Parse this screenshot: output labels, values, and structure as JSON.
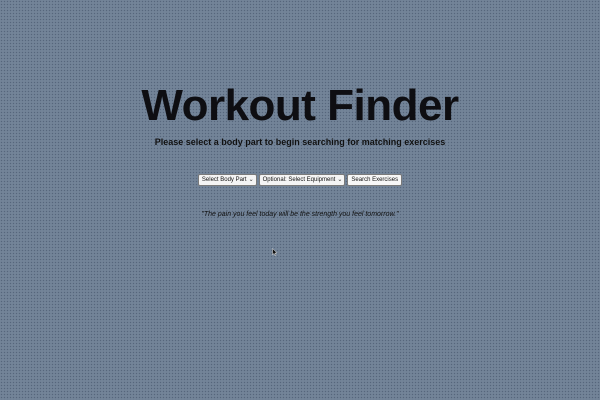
{
  "header": {
    "title": "Workout Finder",
    "subtitle": "Please select a body part to begin searching for matching exercises"
  },
  "controls": {
    "body_part_select": {
      "selected": "Select Body Part"
    },
    "equipment_select": {
      "selected": "Optional: Select Equipment"
    },
    "search_button_label": "Search Exercises"
  },
  "quote": {
    "text": "\"The pain you feel today will be the strength you feel tomorrow.\""
  },
  "icons": {
    "dropdown": "chevron-down-icon",
    "pointer": "mouse-pointer-icon"
  },
  "colors": {
    "background": "#6f8095",
    "text": "#0e0e12"
  }
}
